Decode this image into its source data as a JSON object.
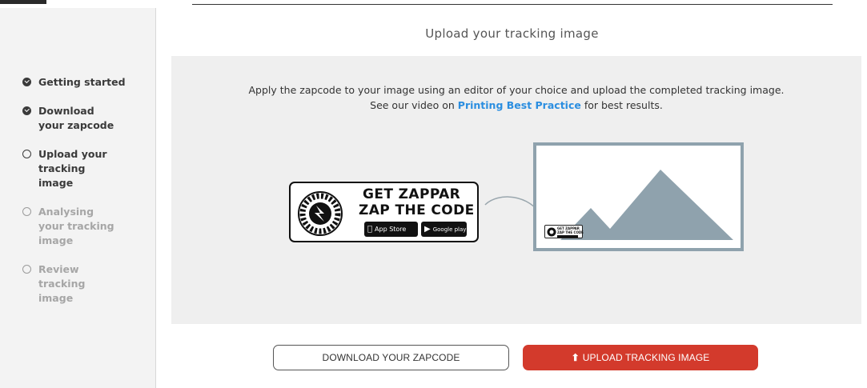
{
  "page": {
    "title": "Upload your tracking image"
  },
  "sidebar": {
    "steps": [
      {
        "label": "Getting started",
        "state": "done",
        "icon": "check-circle-icon"
      },
      {
        "label": "Download your zapcode",
        "state": "done",
        "icon": "check-circle-icon"
      },
      {
        "label": "Upload your tracking image",
        "state": "current",
        "icon": "circle-outline-icon"
      },
      {
        "label": "Analysing your tracking image",
        "state": "pending",
        "icon": "circle-outline-icon"
      },
      {
        "label": "Review tracking image",
        "state": "pending",
        "icon": "circle-outline-icon"
      }
    ]
  },
  "instructions": {
    "line1": "Apply the zapcode to your image using an editor of your choice and upload the completed tracking image.",
    "line2_prefix": "See our video on ",
    "link": "Printing Best Practice",
    "line2_suffix": " for best results."
  },
  "zapcode_badge": {
    "line1": "GET ZAPPAR",
    "line2": "ZAP THE CODE",
    "app_store": "App Store",
    "google_play": "Google play"
  },
  "mini_badge": {
    "line1": "GET ZAPPAR",
    "line2": "ZAP THE CODE"
  },
  "buttons": {
    "download": "DOWNLOAD YOUR ZAPCODE",
    "upload": "UPLOAD TRACKING IMAGE"
  },
  "colors": {
    "accent_red": "#d33a2c",
    "link_blue": "#2b8ee0",
    "frame_grey": "#8fa2ad"
  }
}
